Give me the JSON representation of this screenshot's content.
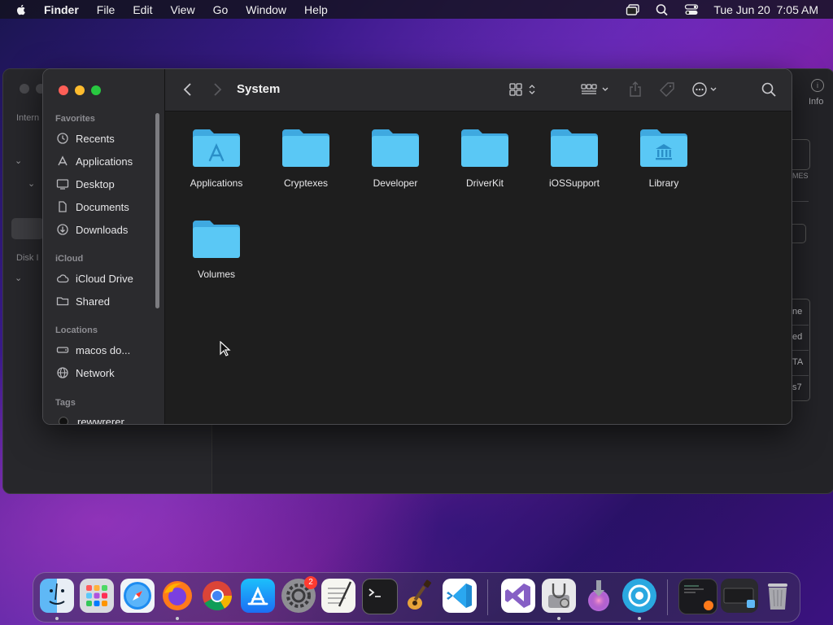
{
  "menubar": {
    "app_name": "Finder",
    "items": [
      "File",
      "Edit",
      "View",
      "Go",
      "Window",
      "Help"
    ],
    "datetime": "Tue Jun 20  7:05 AM"
  },
  "background_window": {
    "labels": [
      "Intern",
      "Disk I"
    ],
    "info_label": "Info",
    "right_texts": [
      "MES",
      "ne",
      "ed",
      "TA",
      "s7"
    ]
  },
  "finder": {
    "title": "System",
    "sidebar": {
      "favorites_header": "Favorites",
      "favorites": [
        {
          "label": "Recents",
          "icon": "clock-icon"
        },
        {
          "label": "Applications",
          "icon": "app-icon"
        },
        {
          "label": "Desktop",
          "icon": "desktop-icon"
        },
        {
          "label": "Documents",
          "icon": "document-icon"
        },
        {
          "label": "Downloads",
          "icon": "download-icon"
        }
      ],
      "icloud_header": "iCloud",
      "icloud": [
        {
          "label": "iCloud Drive",
          "icon": "cloud-icon"
        },
        {
          "label": "Shared",
          "icon": "shared-folder-icon"
        }
      ],
      "locations_header": "Locations",
      "locations": [
        {
          "label": "macos do...",
          "icon": "disk-icon"
        },
        {
          "label": "Network",
          "icon": "globe-icon"
        }
      ],
      "tags_header": "Tags",
      "tags": [
        {
          "label": "rewwrerer",
          "color": "#111111"
        }
      ]
    },
    "items": [
      {
        "label": "Applications",
        "glyph": "apps"
      },
      {
        "label": "Cryptexes",
        "glyph": ""
      },
      {
        "label": "Developer",
        "glyph": ""
      },
      {
        "label": "DriverKit",
        "glyph": ""
      },
      {
        "label": "iOSSupport",
        "glyph": ""
      },
      {
        "label": "Library",
        "glyph": "library"
      },
      {
        "label": "Volumes",
        "glyph": ""
      }
    ]
  },
  "dock": {
    "settings_badge": "2",
    "apps": [
      "finder",
      "launchpad",
      "safari",
      "firefox",
      "chrome",
      "app-store",
      "system-settings",
      "textedit",
      "terminal",
      "garageband",
      "vscode",
      "visual-studio",
      "disk-utility",
      "installer",
      "xcode-instruments",
      "window-preview-1",
      "window-preview-2",
      "trash"
    ]
  },
  "colors": {
    "folder_blue": "#5ac8f5",
    "folder_tab": "#3fa9e0",
    "window_bg": "#1e1e1e",
    "sidebar_bg": "#2b2b2e"
  }
}
